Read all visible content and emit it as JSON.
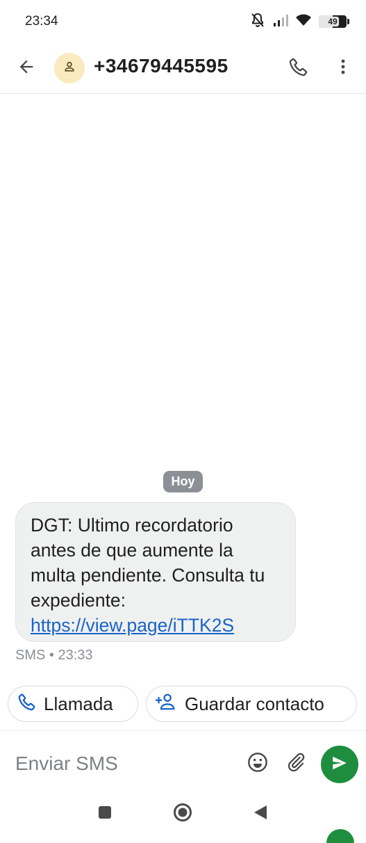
{
  "status_bar": {
    "time": "23:34",
    "battery_level": "49",
    "icons": [
      "mute-icon",
      "signal-icon",
      "wifi-icon",
      "battery-icon"
    ]
  },
  "app_bar": {
    "contact": "+34679445595",
    "icons": [
      "back-arrow-icon",
      "person-icon",
      "phone-icon",
      "more-vert-icon"
    ]
  },
  "conversation": {
    "date_label": "Hoy",
    "message": {
      "text": "DGT: Ultimo recordatorio antes de que aumente la multa pendiente. Consulta tu expediente:",
      "link": "https://view.page/iTTK2S",
      "meta": "SMS • 23:33"
    }
  },
  "suggestions": {
    "call_label": "Llamada",
    "save_label": "Guardar contacto"
  },
  "composer": {
    "placeholder": "Enviar SMS",
    "icons": [
      "emoji-icon",
      "attach-icon",
      "send-icon"
    ]
  },
  "colors": {
    "accent_green": "#1e8e3e",
    "link_blue": "#1a63c9",
    "chip_icon_blue": "#1a63c9",
    "bubble_bg": "#eff1f0",
    "date_chip_bg": "#8c9096",
    "avatar_bg": "#fbeac0"
  }
}
